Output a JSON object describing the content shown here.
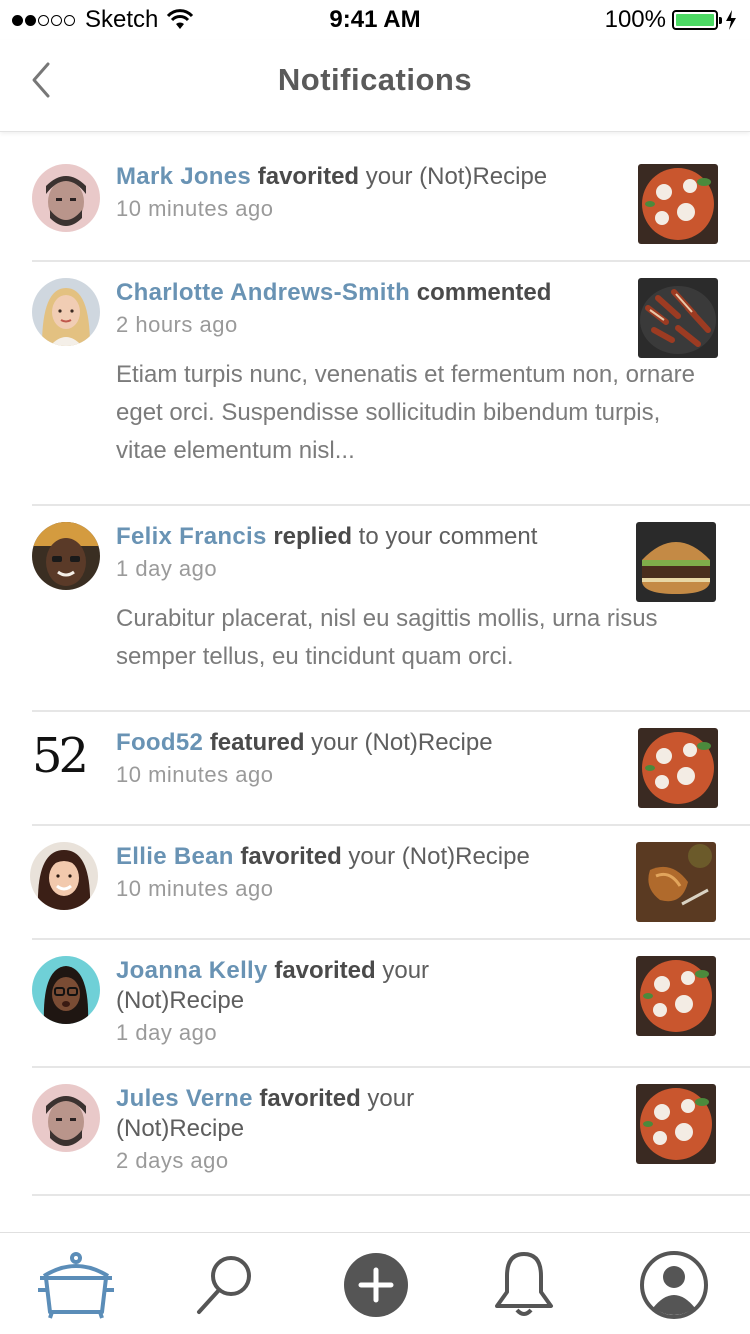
{
  "status_bar": {
    "carrier": "Sketch",
    "time": "9:41 AM",
    "battery": "100%"
  },
  "nav": {
    "title": "Notifications"
  },
  "notifications": [
    {
      "name": "Mark Jones",
      "verb": "favorited",
      "rest": " your (Not)Recipe",
      "time": "10 minutes ago"
    },
    {
      "name": "Charlotte Andrews-Smith",
      "verb": "commented",
      "rest": "",
      "time": "2 hours ago",
      "comment": "Etiam turpis nunc, venenatis et fermentum non, ornare eget orci. Suspendisse sollicitudin bibendum turpis, vitae elementum nisl..."
    },
    {
      "name": "Felix Francis",
      "verb": "replied",
      "rest": " to your comment",
      "time": "1 day ago",
      "comment": "Curabitur placerat, nisl eu sagittis mollis, urna risus semper tellus, eu tincidunt quam orci."
    },
    {
      "name": "Food52",
      "verb": "featured",
      "rest": " your (Not)Recipe",
      "time": "10 minutes ago",
      "logo": "52"
    },
    {
      "name": "Ellie Bean",
      "verb": "favorited",
      "rest": " your (Not)Recipe",
      "time": "10 minutes ago"
    },
    {
      "name": "Joanna Kelly",
      "verb": "favorited",
      "rest": " your (Not)Recipe",
      "time": "1 day ago"
    },
    {
      "name": "Jules Verne",
      "verb": "favorited",
      "rest": " your (Not)Recipe",
      "time": "2 days ago"
    }
  ],
  "tab_bar": {
    "tabs": [
      "pot-icon",
      "search-icon",
      "add-icon",
      "bell-icon",
      "profile-icon"
    ],
    "active_color": "#5b8db8",
    "inactive_color": "#555555"
  }
}
